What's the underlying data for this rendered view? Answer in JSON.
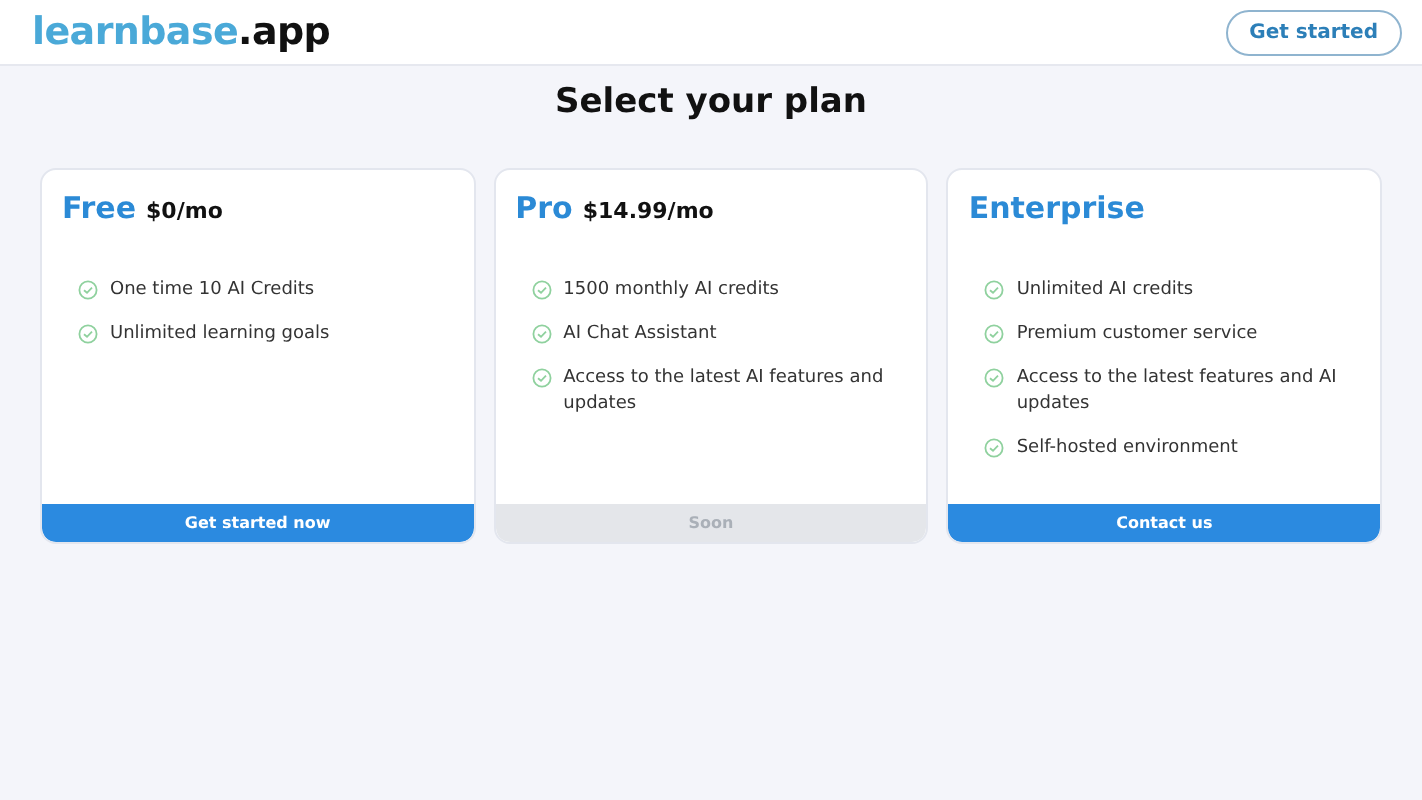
{
  "header": {
    "logo": {
      "name": "learnbase",
      "suffix": ".app"
    },
    "cta": "Get started"
  },
  "title": "Select your plan",
  "plans": [
    {
      "name": "Free",
      "price": "$0/mo",
      "features": [
        "One time 10 AI Credits",
        "Unlimited learning goals"
      ],
      "button": {
        "label": "Get started now",
        "disabled": false
      }
    },
    {
      "name": "Pro",
      "price": "$14.99/mo",
      "features": [
        "1500 monthly AI credits",
        "AI Chat Assistant",
        "Access to the latest AI features and updates"
      ],
      "button": {
        "label": "Soon",
        "disabled": true
      }
    },
    {
      "name": "Enterprise",
      "features": [
        "Unlimited AI credits",
        "Premium customer service",
        "Access to the latest features and AI updates",
        "Self-hosted environment"
      ],
      "button": {
        "label": "Contact us",
        "disabled": false
      }
    }
  ]
}
